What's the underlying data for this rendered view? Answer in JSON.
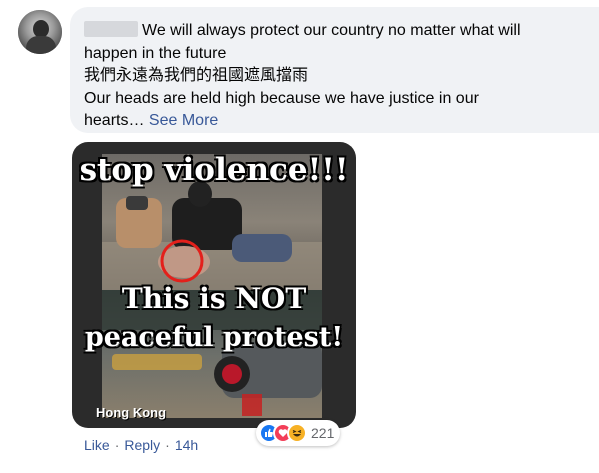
{
  "comment": {
    "author_name": "",
    "line1": "We will always protect our country no matter what will",
    "line2": "happen in the future",
    "line3": "我們永遠為我們的祖國遮風擋雨",
    "line4": "Our heads are held high because we have justice in our",
    "line5_prefix": "hearts…",
    "see_more": "See More"
  },
  "image": {
    "top_text": "stop violence!!!",
    "middle_text": "This is NOT",
    "bottom_text": "peaceful protest!",
    "location_label": "Hong Kong"
  },
  "actions": {
    "like": "Like",
    "reply": "Reply",
    "timestamp": "14h",
    "separator": "·"
  },
  "reactions": {
    "icons": [
      "like-icon",
      "love-icon",
      "haha-icon"
    ],
    "count": "221"
  },
  "colors": {
    "bubble_bg": "#f0f2f5",
    "link": "#385898",
    "meta_text": "#65676b",
    "like_blue": "#1877f2",
    "love_red": "#f33e58",
    "haha_yellow": "#f7b125"
  }
}
